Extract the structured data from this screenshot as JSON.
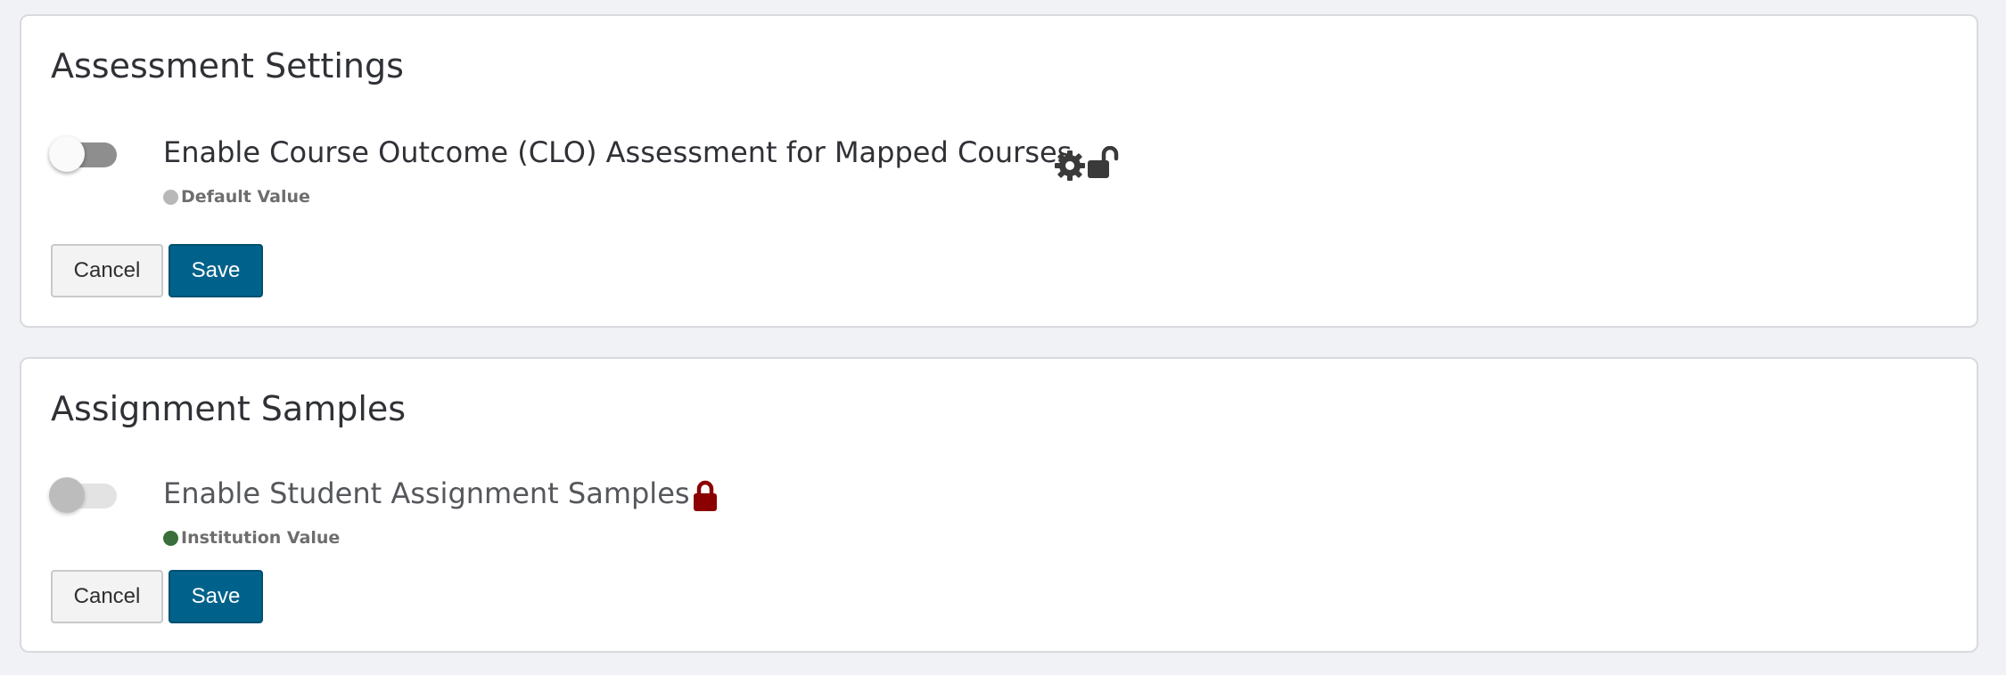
{
  "colors": {
    "page_background": "#f1f2f5",
    "primary_button": "#00628b",
    "default_value_dot": "#b8b8b8",
    "institution_value_dot": "#3a6e3a",
    "lock_icon": "#8b0000",
    "icon_dark": "#3a3a3a"
  },
  "sections": [
    {
      "title": "Assessment Settings",
      "setting": {
        "label": "Enable Course Outcome (CLO) Assessment for Mapped Courses",
        "toggle_state": "off",
        "value_source": "Default Value",
        "icons": [
          "gear-icon",
          "unlock-icon"
        ]
      },
      "buttons": {
        "cancel_label": "Cancel",
        "save_label": "Save"
      }
    },
    {
      "title": "Assignment Samples",
      "setting": {
        "label": "Enable Student Assignment Samples",
        "toggle_state": "off-disabled",
        "value_source": "Institution Value",
        "icons": [
          "lock-icon"
        ]
      },
      "buttons": {
        "cancel_label": "Cancel",
        "save_label": "Save"
      }
    }
  ]
}
